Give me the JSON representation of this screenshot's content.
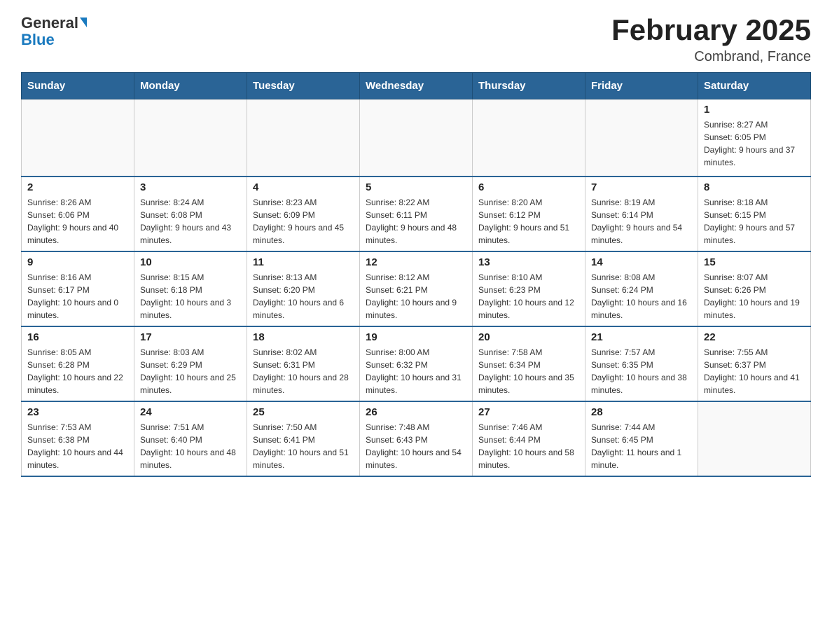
{
  "header": {
    "logo_general": "General",
    "logo_blue": "Blue",
    "title": "February 2025",
    "subtitle": "Combrand, France"
  },
  "days_of_week": [
    "Sunday",
    "Monday",
    "Tuesday",
    "Wednesday",
    "Thursday",
    "Friday",
    "Saturday"
  ],
  "weeks": [
    [
      {
        "day": "",
        "info": ""
      },
      {
        "day": "",
        "info": ""
      },
      {
        "day": "",
        "info": ""
      },
      {
        "day": "",
        "info": ""
      },
      {
        "day": "",
        "info": ""
      },
      {
        "day": "",
        "info": ""
      },
      {
        "day": "1",
        "info": "Sunrise: 8:27 AM\nSunset: 6:05 PM\nDaylight: 9 hours and 37 minutes."
      }
    ],
    [
      {
        "day": "2",
        "info": "Sunrise: 8:26 AM\nSunset: 6:06 PM\nDaylight: 9 hours and 40 minutes."
      },
      {
        "day": "3",
        "info": "Sunrise: 8:24 AM\nSunset: 6:08 PM\nDaylight: 9 hours and 43 minutes."
      },
      {
        "day": "4",
        "info": "Sunrise: 8:23 AM\nSunset: 6:09 PM\nDaylight: 9 hours and 45 minutes."
      },
      {
        "day": "5",
        "info": "Sunrise: 8:22 AM\nSunset: 6:11 PM\nDaylight: 9 hours and 48 minutes."
      },
      {
        "day": "6",
        "info": "Sunrise: 8:20 AM\nSunset: 6:12 PM\nDaylight: 9 hours and 51 minutes."
      },
      {
        "day": "7",
        "info": "Sunrise: 8:19 AM\nSunset: 6:14 PM\nDaylight: 9 hours and 54 minutes."
      },
      {
        "day": "8",
        "info": "Sunrise: 8:18 AM\nSunset: 6:15 PM\nDaylight: 9 hours and 57 minutes."
      }
    ],
    [
      {
        "day": "9",
        "info": "Sunrise: 8:16 AM\nSunset: 6:17 PM\nDaylight: 10 hours and 0 minutes."
      },
      {
        "day": "10",
        "info": "Sunrise: 8:15 AM\nSunset: 6:18 PM\nDaylight: 10 hours and 3 minutes."
      },
      {
        "day": "11",
        "info": "Sunrise: 8:13 AM\nSunset: 6:20 PM\nDaylight: 10 hours and 6 minutes."
      },
      {
        "day": "12",
        "info": "Sunrise: 8:12 AM\nSunset: 6:21 PM\nDaylight: 10 hours and 9 minutes."
      },
      {
        "day": "13",
        "info": "Sunrise: 8:10 AM\nSunset: 6:23 PM\nDaylight: 10 hours and 12 minutes."
      },
      {
        "day": "14",
        "info": "Sunrise: 8:08 AM\nSunset: 6:24 PM\nDaylight: 10 hours and 16 minutes."
      },
      {
        "day": "15",
        "info": "Sunrise: 8:07 AM\nSunset: 6:26 PM\nDaylight: 10 hours and 19 minutes."
      }
    ],
    [
      {
        "day": "16",
        "info": "Sunrise: 8:05 AM\nSunset: 6:28 PM\nDaylight: 10 hours and 22 minutes."
      },
      {
        "day": "17",
        "info": "Sunrise: 8:03 AM\nSunset: 6:29 PM\nDaylight: 10 hours and 25 minutes."
      },
      {
        "day": "18",
        "info": "Sunrise: 8:02 AM\nSunset: 6:31 PM\nDaylight: 10 hours and 28 minutes."
      },
      {
        "day": "19",
        "info": "Sunrise: 8:00 AM\nSunset: 6:32 PM\nDaylight: 10 hours and 31 minutes."
      },
      {
        "day": "20",
        "info": "Sunrise: 7:58 AM\nSunset: 6:34 PM\nDaylight: 10 hours and 35 minutes."
      },
      {
        "day": "21",
        "info": "Sunrise: 7:57 AM\nSunset: 6:35 PM\nDaylight: 10 hours and 38 minutes."
      },
      {
        "day": "22",
        "info": "Sunrise: 7:55 AM\nSunset: 6:37 PM\nDaylight: 10 hours and 41 minutes."
      }
    ],
    [
      {
        "day": "23",
        "info": "Sunrise: 7:53 AM\nSunset: 6:38 PM\nDaylight: 10 hours and 44 minutes."
      },
      {
        "day": "24",
        "info": "Sunrise: 7:51 AM\nSunset: 6:40 PM\nDaylight: 10 hours and 48 minutes."
      },
      {
        "day": "25",
        "info": "Sunrise: 7:50 AM\nSunset: 6:41 PM\nDaylight: 10 hours and 51 minutes."
      },
      {
        "day": "26",
        "info": "Sunrise: 7:48 AM\nSunset: 6:43 PM\nDaylight: 10 hours and 54 minutes."
      },
      {
        "day": "27",
        "info": "Sunrise: 7:46 AM\nSunset: 6:44 PM\nDaylight: 10 hours and 58 minutes."
      },
      {
        "day": "28",
        "info": "Sunrise: 7:44 AM\nSunset: 6:45 PM\nDaylight: 11 hours and 1 minute."
      },
      {
        "day": "",
        "info": ""
      }
    ]
  ]
}
